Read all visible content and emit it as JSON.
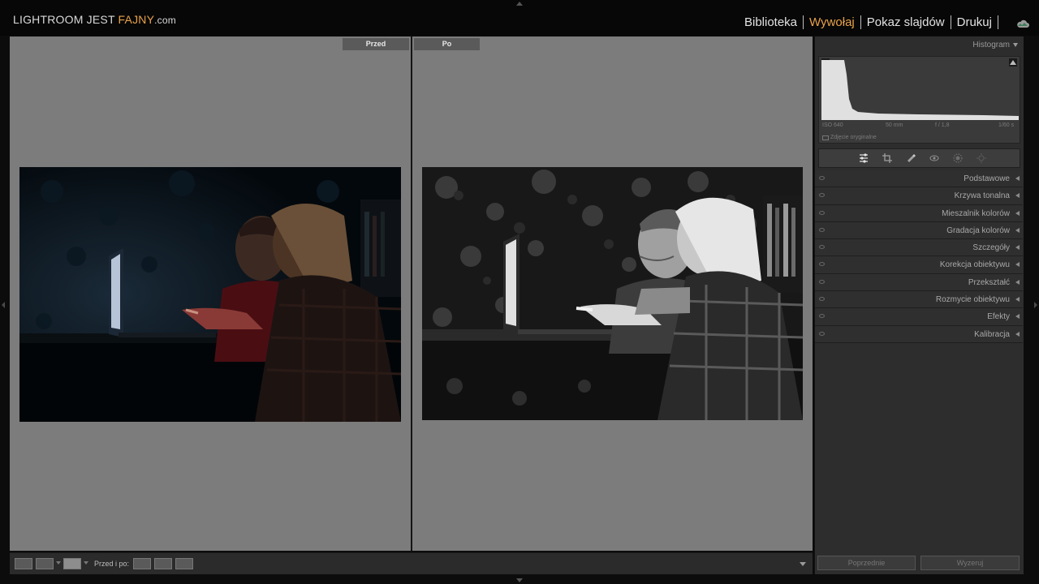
{
  "topbar": {
    "brand_main": "LIGHTROOM JEST ",
    "brand_accent": "FAJNY",
    "brand_suffix": ".com",
    "modules": [
      "Biblioteka",
      "Wywołaj",
      "Pokaz slajdów",
      "Drukuj"
    ],
    "active_module": "Wywołaj",
    "accent_color": "#e8a24a",
    "cloud_icon": "cloud-sync-icon"
  },
  "view": {
    "before_label": "Przed",
    "after_label": "Po"
  },
  "toolbar": {
    "view_buttons": [
      "loupe-view-icon",
      "compare-view-icon",
      "before-after-view-icon"
    ],
    "before_after_label": "Przed i po:",
    "action_icons": [
      "copy-before-to-after-icon",
      "copy-after-to-before-icon",
      "swap-before-after-icon"
    ]
  },
  "panel": {
    "histogram_title": "Histogram",
    "histogram_info": [
      "ISO 640",
      "50 mm",
      "f / 1,8",
      "1/60 s"
    ],
    "original_photo_label": "Zdjęcie oryginalne",
    "tools": [
      "sliders-icon",
      "crop-icon",
      "heal-icon",
      "red-eye-icon",
      "masking-icon",
      "settings-icon"
    ],
    "sections": [
      "Podstawowe",
      "Krzywa tonalna",
      "Mieszalnik kolorów",
      "Gradacja kolorów",
      "Szczegóły",
      "Korekcja obiektywu",
      "Przekształć",
      "Rozmycie obiektywu",
      "Efekty",
      "Kalibracja"
    ],
    "prev_button": "Poprzednie",
    "reset_button": "Wyzeruj"
  }
}
